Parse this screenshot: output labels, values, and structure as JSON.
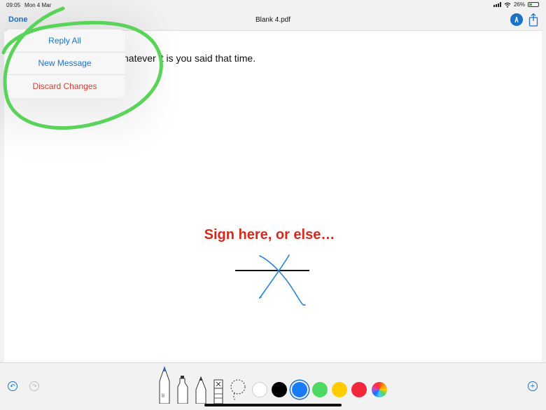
{
  "status_bar": {
    "time": "09:05",
    "date": "Mon 4 Mar",
    "battery": "26%",
    "battery_level": 0.26
  },
  "nav": {
    "done_label": "Done",
    "title": "Blank 4.pdf",
    "markup_icon": "markup-pen-icon",
    "share_icon": "share-icon"
  },
  "popover": {
    "items": [
      {
        "label": "Reply All",
        "style": "default"
      },
      {
        "label": "New Message",
        "style": "default"
      },
      {
        "label": "Discard Changes",
        "style": "destructive"
      }
    ]
  },
  "document": {
    "visible_text": "hatever it is you said that time.",
    "sign_prompt": "Sign here, or else…"
  },
  "toolbar": {
    "undo_icon": "undo-icon",
    "redo_icon": "redo-icon",
    "add_icon": "add-icon",
    "pen_width_label": "97",
    "tools": [
      "pen",
      "marker",
      "pencil",
      "eraser",
      "lasso"
    ],
    "colors": [
      "#ffffff",
      "#000000",
      "#1a7cf5",
      "#4cd964",
      "#ffcc00",
      "#f2273c"
    ],
    "selected_color": "#1a7cf5"
  },
  "colors": {
    "accent": "#1a73c9",
    "destructive": "#d93a2b",
    "annotation_green": "#5ad35a",
    "signature_blue": "#2b7fd6"
  }
}
